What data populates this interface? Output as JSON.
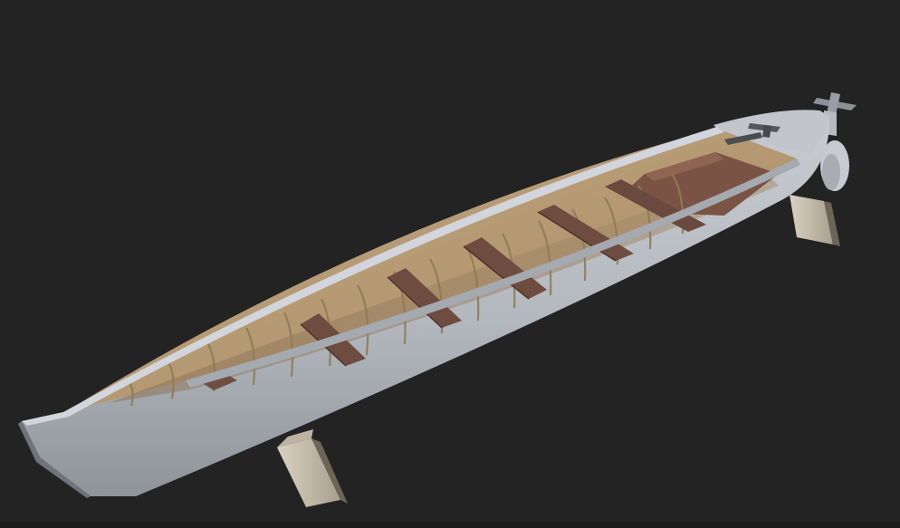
{
  "scene": {
    "background_color": "#232323",
    "hull_color": "#b9bcc3",
    "hull_shadow_color": "#8e9298",
    "interior_color": "#b49a74",
    "rib_color": "#8b7a52",
    "thwart_color": "#6e4c40",
    "stand_color": "#cfc6b6",
    "rudder_color": "#c9ccd2",
    "subject": "rowboat-3d-model"
  }
}
